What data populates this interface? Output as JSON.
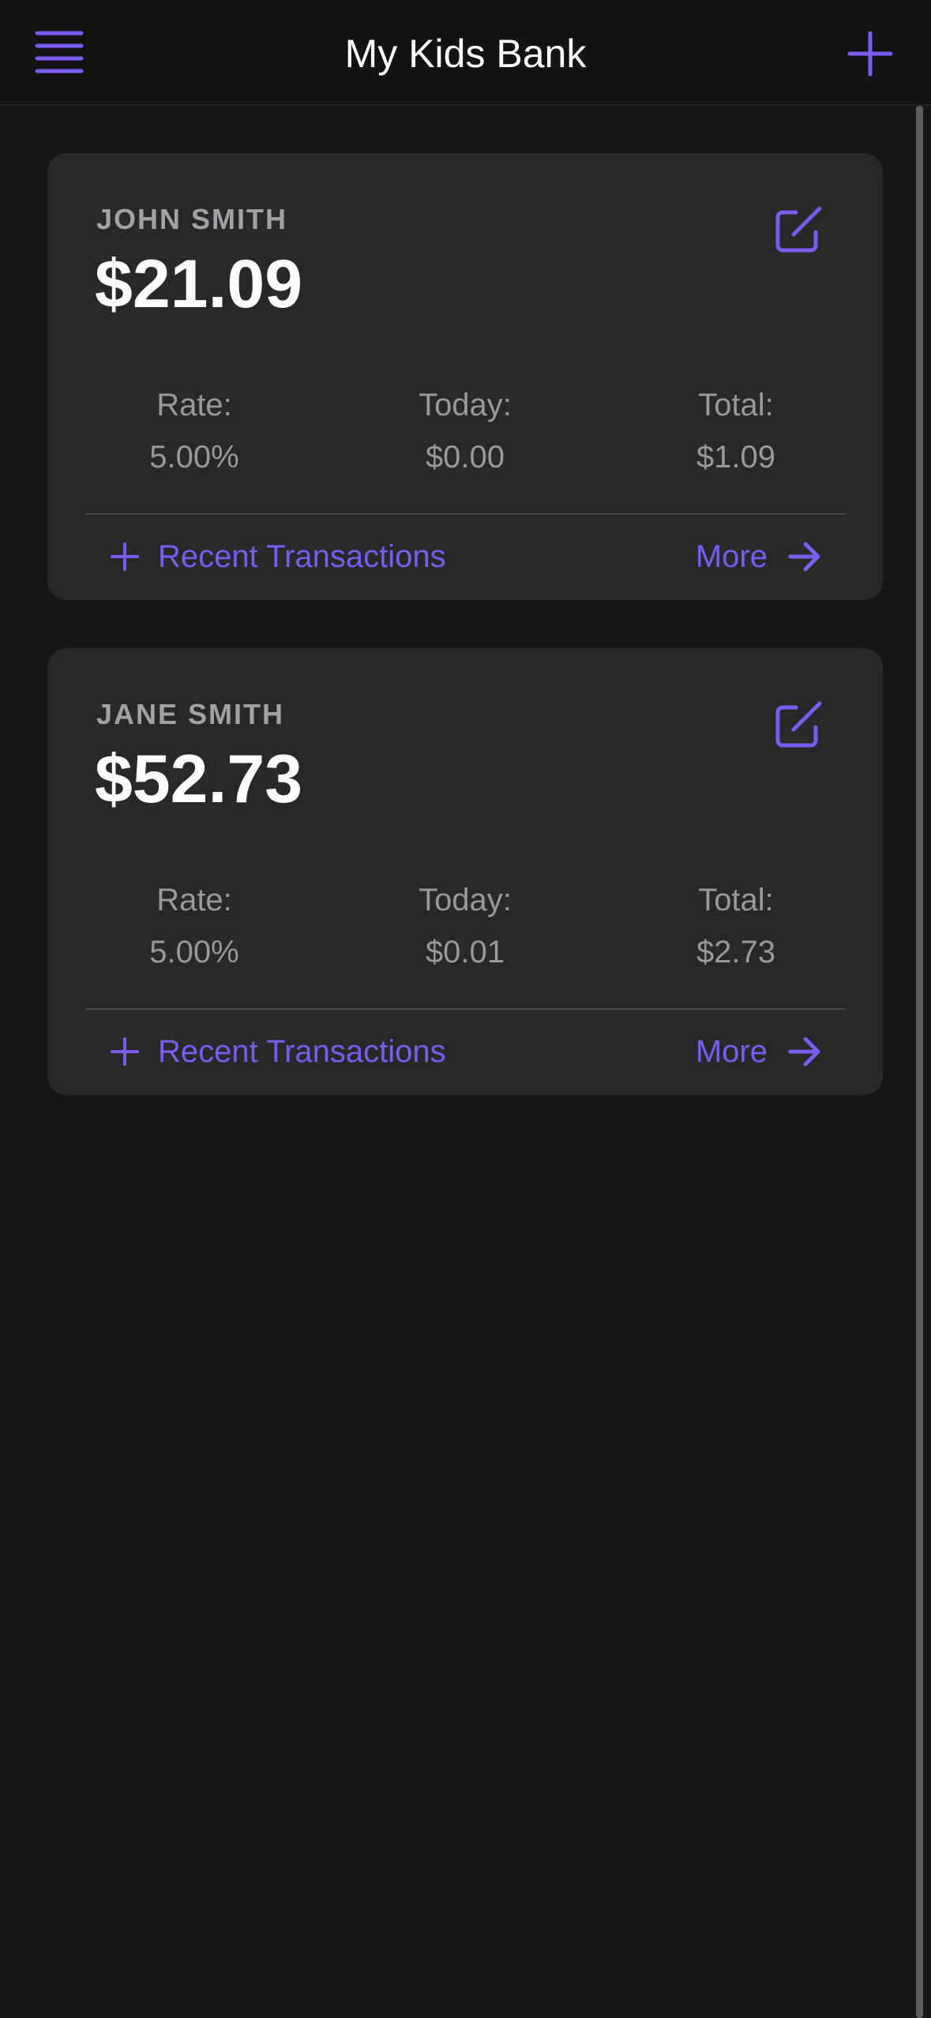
{
  "header": {
    "title": "My Kids Bank"
  },
  "accent_color": "#7a5cf0",
  "accounts": [
    {
      "name": "JOHN SMITH",
      "balance": "$21.09",
      "rate_label": "Rate:",
      "rate": "5.00%",
      "today_label": "Today:",
      "today": "$0.00",
      "total_label": "Total:",
      "total": "$1.09",
      "recent_label": "Recent Transactions",
      "more_label": "More"
    },
    {
      "name": "JANE SMITH",
      "balance": "$52.73",
      "rate_label": "Rate:",
      "rate": "5.00%",
      "today_label": "Today:",
      "today": "$0.01",
      "total_label": "Total:",
      "total": "$2.73",
      "recent_label": "Recent Transactions",
      "more_label": "More"
    }
  ],
  "icons": {
    "menu": "hamburger-menu-icon",
    "add": "plus-icon",
    "edit": "edit-square-pencil-icon",
    "recent": "plus-icon",
    "more": "arrow-right-icon"
  }
}
